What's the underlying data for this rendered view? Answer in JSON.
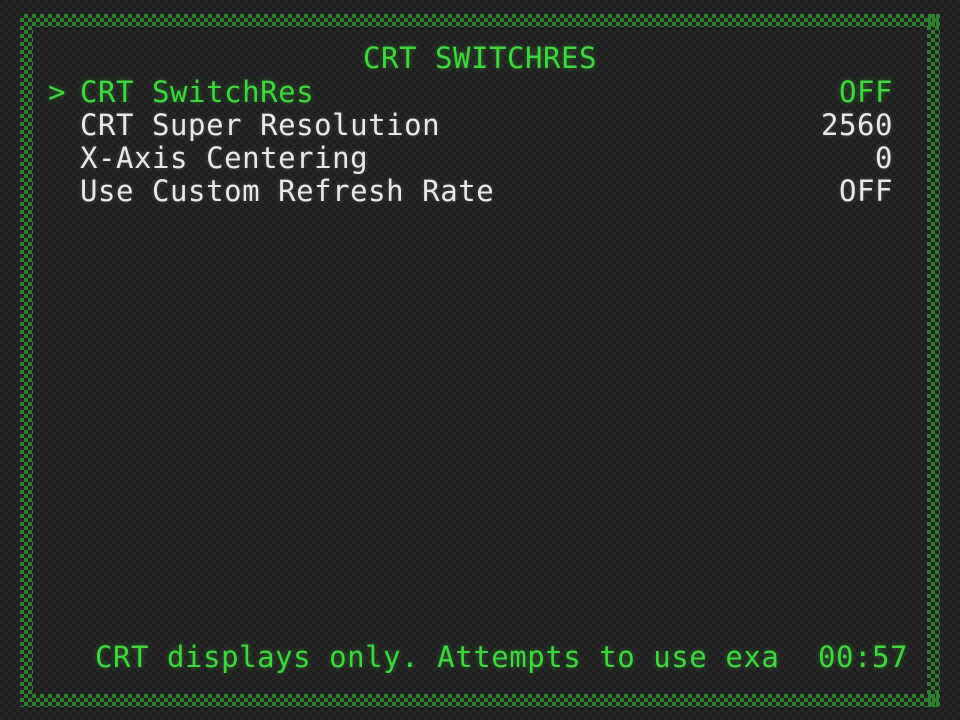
{
  "screen": {
    "title": "CRT SWITCHRES",
    "frame_color": "#2e802e",
    "background_color": "#1e1e1e",
    "accent_color": "#3fd63f",
    "text_color": "#e8e8e8"
  },
  "menu": {
    "cursor_glyph": ">",
    "items": [
      {
        "label": "CRT SwitchRes",
        "value": "OFF",
        "selected": true
      },
      {
        "label": "CRT Super Resolution",
        "value": "2560",
        "selected": false
      },
      {
        "label": "X-Axis Centering",
        "value": "0",
        "selected": false
      },
      {
        "label": "Use Custom Refresh Rate",
        "value": "OFF",
        "selected": false
      }
    ]
  },
  "footer": {
    "hint": "CRT displays only. Attempts to use exa",
    "clock": "00:57"
  }
}
